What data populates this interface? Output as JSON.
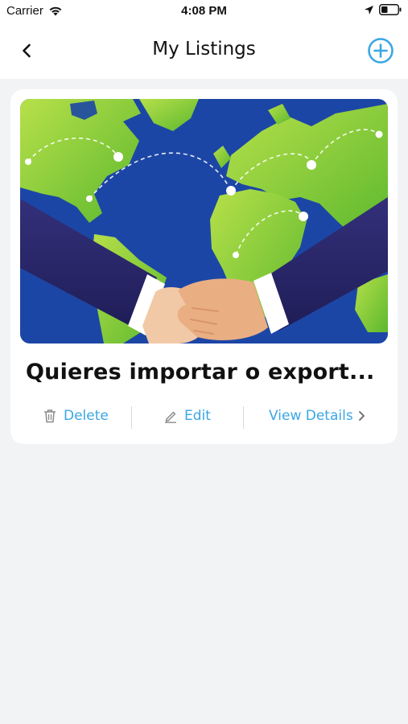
{
  "status_bar": {
    "carrier": "Carrier",
    "time": "4:08 PM"
  },
  "nav": {
    "title": "My Listings"
  },
  "listing": {
    "title": "Quieres importar o export...",
    "actions": {
      "delete": "Delete",
      "edit": "Edit",
      "view_details": "View Details"
    }
  },
  "icons": {
    "back": "chevron-left-icon",
    "add": "plus-circle-icon",
    "delete": "trash-icon",
    "edit": "pencil-icon",
    "view": "chevron-right-icon",
    "wifi": "wifi-icon",
    "location": "location-arrow-icon",
    "battery": "battery-icon"
  },
  "colors": {
    "accent": "#3aa7e4",
    "background": "#f2f3f5",
    "ocean": "#1c46a6",
    "land": "#8fd13a",
    "sleeve": "#2b2a6b"
  }
}
